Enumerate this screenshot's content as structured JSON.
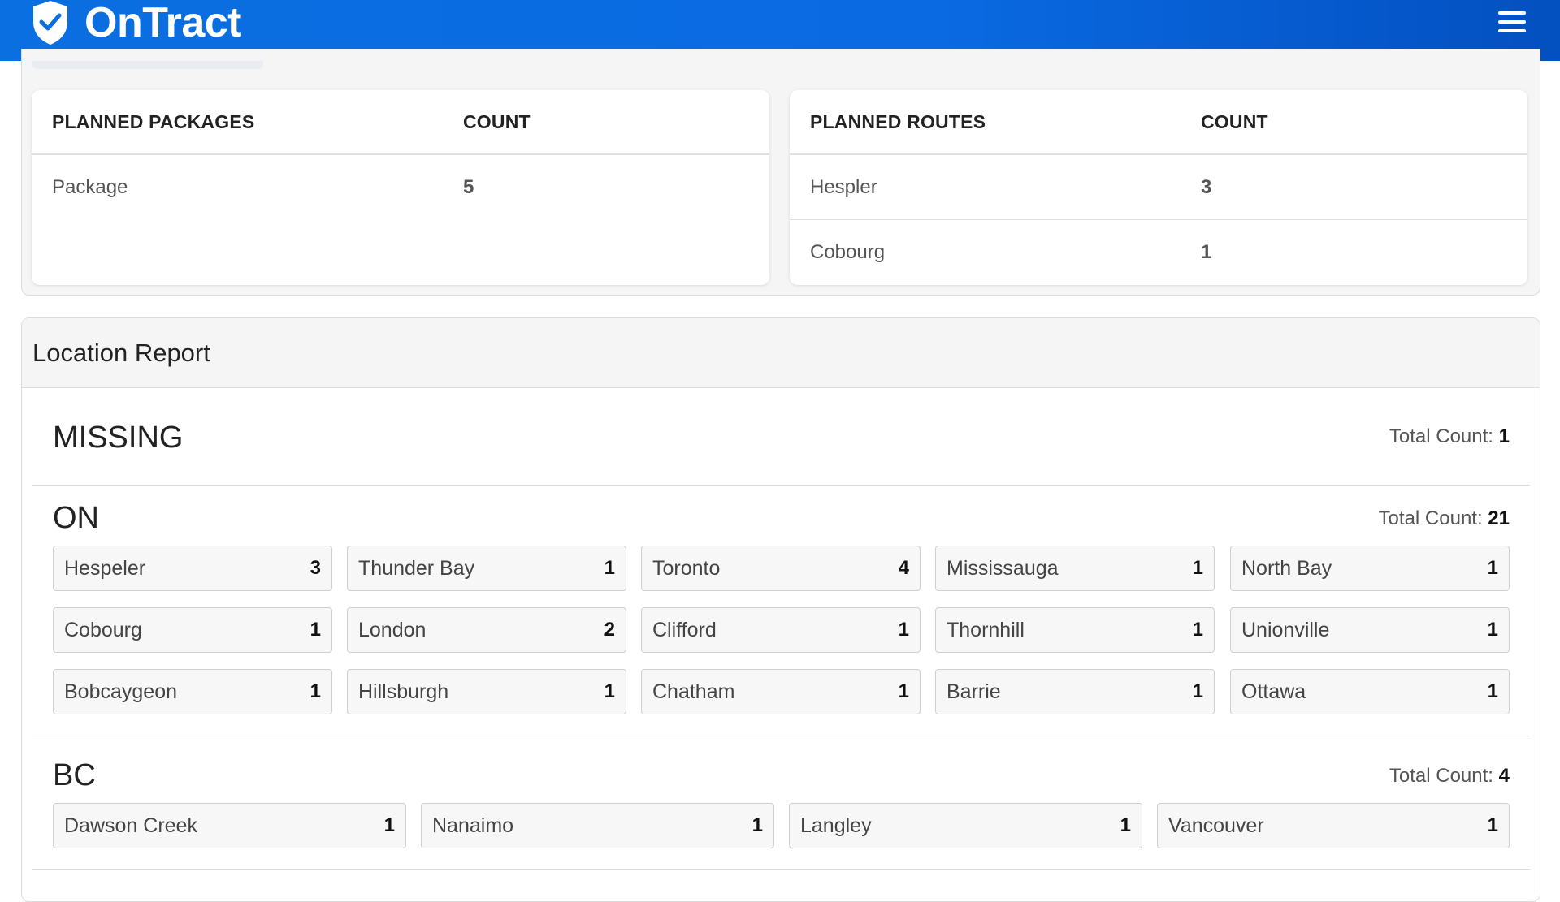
{
  "header": {
    "brand": "OnTract"
  },
  "packages": {
    "head_label": "PLANNED PACKAGES",
    "head_count": "COUNT",
    "rows": [
      {
        "label": "Package",
        "count": "5"
      }
    ]
  },
  "routes": {
    "head_label": "PLANNED ROUTES",
    "head_count": "COUNT",
    "rows": [
      {
        "label": "Hespler",
        "count": "3"
      },
      {
        "label": "Cobourg",
        "count": "1"
      }
    ]
  },
  "report": {
    "title": "Location Report",
    "total_label": "Total Count:",
    "regions": [
      {
        "name": "MISSING",
        "total": "1",
        "locations": []
      },
      {
        "name": "ON",
        "total": "21",
        "locations": [
          {
            "name": "Hespeler",
            "count": "3"
          },
          {
            "name": "Thunder Bay",
            "count": "1"
          },
          {
            "name": "Toronto",
            "count": "4"
          },
          {
            "name": "Mississauga",
            "count": "1"
          },
          {
            "name": "North Bay",
            "count": "1"
          },
          {
            "name": "Cobourg",
            "count": "1"
          },
          {
            "name": "London",
            "count": "2"
          },
          {
            "name": "Clifford",
            "count": "1"
          },
          {
            "name": "Thornhill",
            "count": "1"
          },
          {
            "name": "Unionville",
            "count": "1"
          },
          {
            "name": "Bobcaygeon",
            "count": "1"
          },
          {
            "name": "Hillsburgh",
            "count": "1"
          },
          {
            "name": "Chatham",
            "count": "1"
          },
          {
            "name": "Barrie",
            "count": "1"
          },
          {
            "name": "Ottawa",
            "count": "1"
          }
        ]
      },
      {
        "name": "BC",
        "total": "4",
        "locations": [
          {
            "name": "Dawson Creek",
            "count": "1"
          },
          {
            "name": "Nanaimo",
            "count": "1"
          },
          {
            "name": "Langley",
            "count": "1"
          },
          {
            "name": "Vancouver",
            "count": "1"
          }
        ]
      }
    ]
  },
  "icons": {
    "brand": "shield-check-icon",
    "menu": "hamburger-menu-icon"
  },
  "colors": {
    "header_start": "#0a6fe0",
    "header_end": "#0350c0"
  }
}
